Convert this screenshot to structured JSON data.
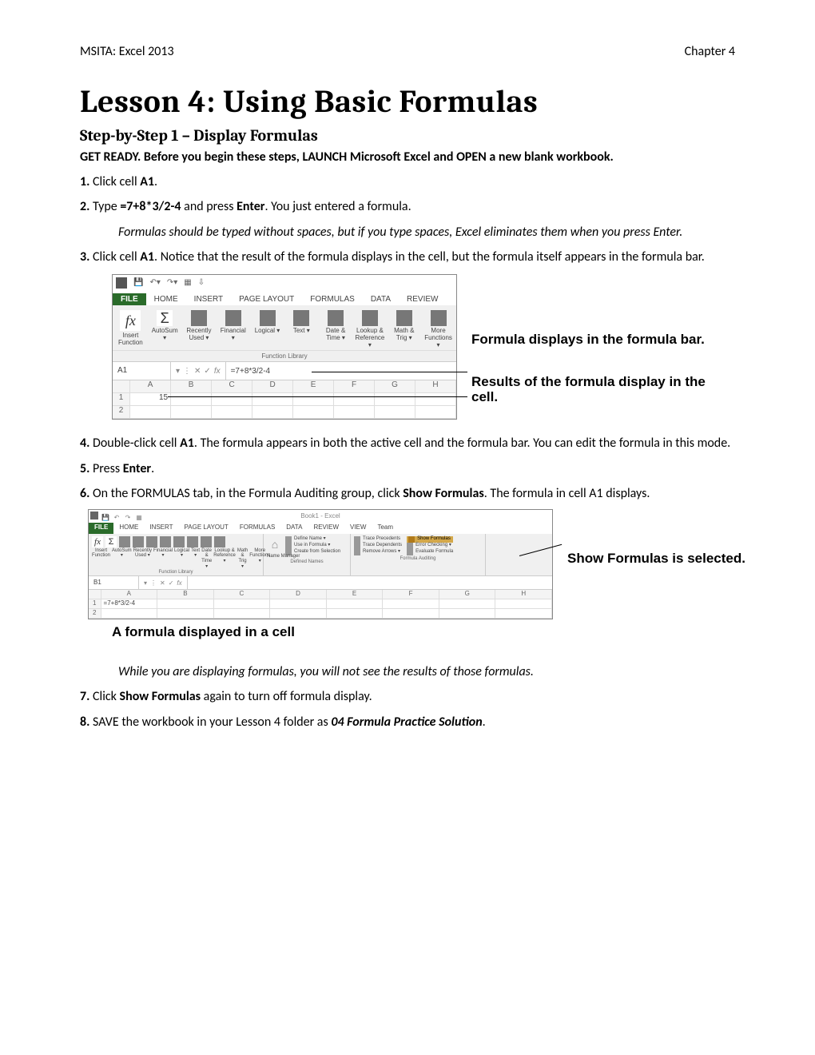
{
  "header": {
    "left": "MSITA: Excel 2013",
    "right": "Chapter 4"
  },
  "title": "Lesson 4: Using Basic Formulas",
  "subtitle": "Step-by-Step 1 – Display Formulas",
  "intro_prefix": "GET READY. ",
  "intro_rest": "Before you begin these steps, LAUNCH Microsoft Excel and OPEN a new blank workbook.",
  "steps": {
    "s1_num": "1.",
    "s1_a": " Click cell ",
    "s1_b": "A1",
    "s1_c": ".",
    "s2_num": "2.",
    "s2_a": " Type ",
    "s2_b": "=7+8*3/2-4",
    "s2_c": " and press ",
    "s2_d": "Enter",
    "s2_e": ". You just entered a formula.",
    "note1": "Formulas should be typed without spaces, but if you type spaces, Excel eliminates them when you press Enter.",
    "s3_num": "3.",
    "s3_a": " Click cell ",
    "s3_b": "A1",
    "s3_c": ". Notice that the result of the formula displays in the cell, but the formula itself appears in the formula bar.",
    "s4_num": "4.",
    "s4_a": " Double-click cell ",
    "s4_b": "A1",
    "s4_c": ". The formula appears in both the active cell and the formula bar.  You can edit the formula in this mode.",
    "s5_num": "5.",
    "s5_a": " Press ",
    "s5_b": "Enter",
    "s5_c": ".",
    "s6_num": "6.",
    "s6_a": " On the FORMULAS tab, in the Formula Auditing group, click ",
    "s6_b": "Show Formulas",
    "s6_c": ". The formula in cell A1 displays.",
    "note2": "While you are displaying formulas, you will not see the results of those formulas.",
    "s7_num": "7.",
    "s7_a": " Click ",
    "s7_b": "Show Formulas",
    "s7_c": " again to turn off formula display.",
    "s8_num": "8.",
    "s8_a": " SAVE the workbook in your Lesson 4 folder as ",
    "s8_b": "04 Formula Practice Solution",
    "s8_c": "."
  },
  "shot1": {
    "tabs": {
      "file": "FILE",
      "home": "HOME",
      "insert": "INSERT",
      "page_layout": "PAGE LAYOUT",
      "formulas": "FORMULAS",
      "data": "DATA",
      "review": "REVIEW"
    },
    "btns": {
      "insert_fn_icon": "fx",
      "insert_fn": "Insert Function",
      "autosum_icon": "Σ",
      "autosum": "AutoSum ▾",
      "recently": "Recently Used ▾",
      "financial": "Financial ▾",
      "logical": "Logical ▾",
      "text": "Text ▾",
      "datetime": "Date & Time ▾",
      "lookup": "Lookup & Reference ▾",
      "math": "Math & Trig ▾",
      "more": "More Functions ▾"
    },
    "group_label": "Function Library",
    "name_box": "A1",
    "fx_label": "fx",
    "formula": "=7+8*3/2-4",
    "cols": [
      "A",
      "B",
      "C",
      "D",
      "E",
      "F",
      "G",
      "H"
    ],
    "rows": [
      "1",
      "2"
    ],
    "cell_a1": "15",
    "callout1": "Formula displays in the formula bar.",
    "callout2": "Results of the formula display in the cell."
  },
  "shot2": {
    "title": "Book1 - Excel",
    "tabs": {
      "file": "FILE",
      "home": "HOME",
      "insert": "INSERT",
      "page_layout": "PAGE LAYOUT",
      "formulas": "FORMULAS",
      "data": "DATA",
      "review": "REVIEW",
      "view": "VIEW",
      "team": "Team"
    },
    "funclib": {
      "insert_fn_icon": "fx",
      "insert_fn": "Insert Function",
      "autosum": "AutoSum ▾",
      "recently": "Recently Used ▾",
      "financial": "Financial ▾",
      "logical": "Logical ▾",
      "text": "Text ▾",
      "datetime": "Date & Time ▾",
      "lookup": "Lookup & Reference ▾",
      "math": "Math & Trig ▾",
      "more": "More Functions ▾",
      "group": "Function Library"
    },
    "defnames": {
      "icon": "⌂",
      "name_mgr": "Name Manager",
      "r1": "Define Name ▾",
      "r2": "Use in Formula ▾",
      "r3": "Create from Selection",
      "group": "Defined Names"
    },
    "audit": {
      "r1": "Trace Precedents",
      "r2": "Trace Dependents",
      "r3": "Remove Arrows ▾",
      "r4": "Show Formulas",
      "r5": "Error Checking ▾",
      "r6": "Evaluate Formula",
      "group": "Formula Auditing"
    },
    "name_box": "B1",
    "fx_label": "fx",
    "cols": [
      "A",
      "B",
      "C",
      "D",
      "E",
      "F",
      "G",
      "H"
    ],
    "rows": [
      "1",
      "2"
    ],
    "cell_a1": "=7+8*3/2-4",
    "callout": "Show Formulas is selected.",
    "caption": "A formula displayed in a cell"
  }
}
